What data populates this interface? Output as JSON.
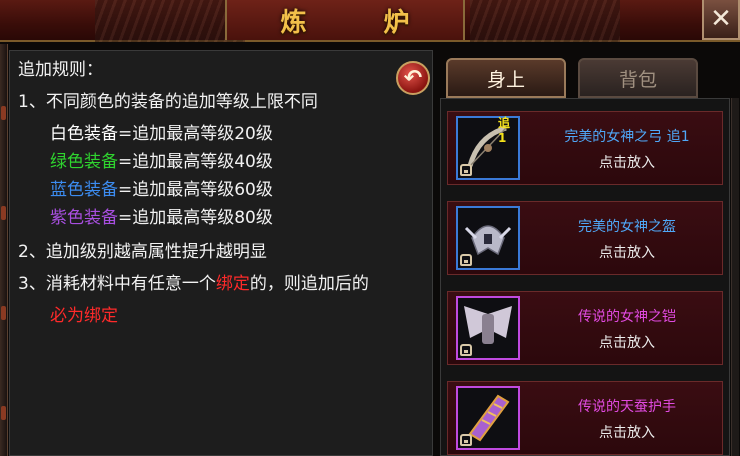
{
  "window": {
    "title": "炼 炉",
    "close_label": "✕"
  },
  "rules": {
    "heading": "追加规则：",
    "rule1": "1、不同颜色的装备的追加等级上限不同",
    "tiers": [
      {
        "color_name": "白色装备",
        "limit": "=追加最高等级20级",
        "color": "#ffffff"
      },
      {
        "color_name": "绿色装备",
        "limit": "=追加最高等级40级",
        "color": "#2fd42f"
      },
      {
        "color_name": "蓝色装备",
        "limit": "=追加最高等级60级",
        "color": "#3c8cf0"
      },
      {
        "color_name": "紫色装备",
        "limit": "=追加最高等级80级",
        "color": "#a84fe0"
      }
    ],
    "rule2": "2、追加级别越高属性提升越明显",
    "rule3_prefix": "3、消耗材料中有任意一个",
    "rule3_bound": "绑定",
    "rule3_suffix": "的，则追加后的",
    "rule3_end": "必为绑定"
  },
  "back_button": {
    "icon": "return-arrow-icon",
    "glyph": "↶"
  },
  "tabs": [
    {
      "label": "身上",
      "active": true
    },
    {
      "label": "背包",
      "active": false
    }
  ],
  "items": [
    {
      "name": "完美的女神之弓 追1",
      "action": "点击放入",
      "badge": "追1",
      "icon": "bow-icon",
      "quality": "blue"
    },
    {
      "name": "完美的女神之盔",
      "action": "点击放入",
      "badge": "",
      "icon": "helmet-icon",
      "quality": "blue"
    },
    {
      "name": "传说的女神之铠",
      "action": "点击放入",
      "badge": "",
      "icon": "winged-armor-icon",
      "quality": "purple"
    },
    {
      "name": "传说的天蚕护手",
      "action": "点击放入",
      "badge": "",
      "icon": "gauntlet-icon",
      "quality": "purple"
    }
  ],
  "colors": {
    "accent_gold": "#f2c04a",
    "panel_red": "#3a0d12",
    "bound_red": "#ff2a2a"
  }
}
